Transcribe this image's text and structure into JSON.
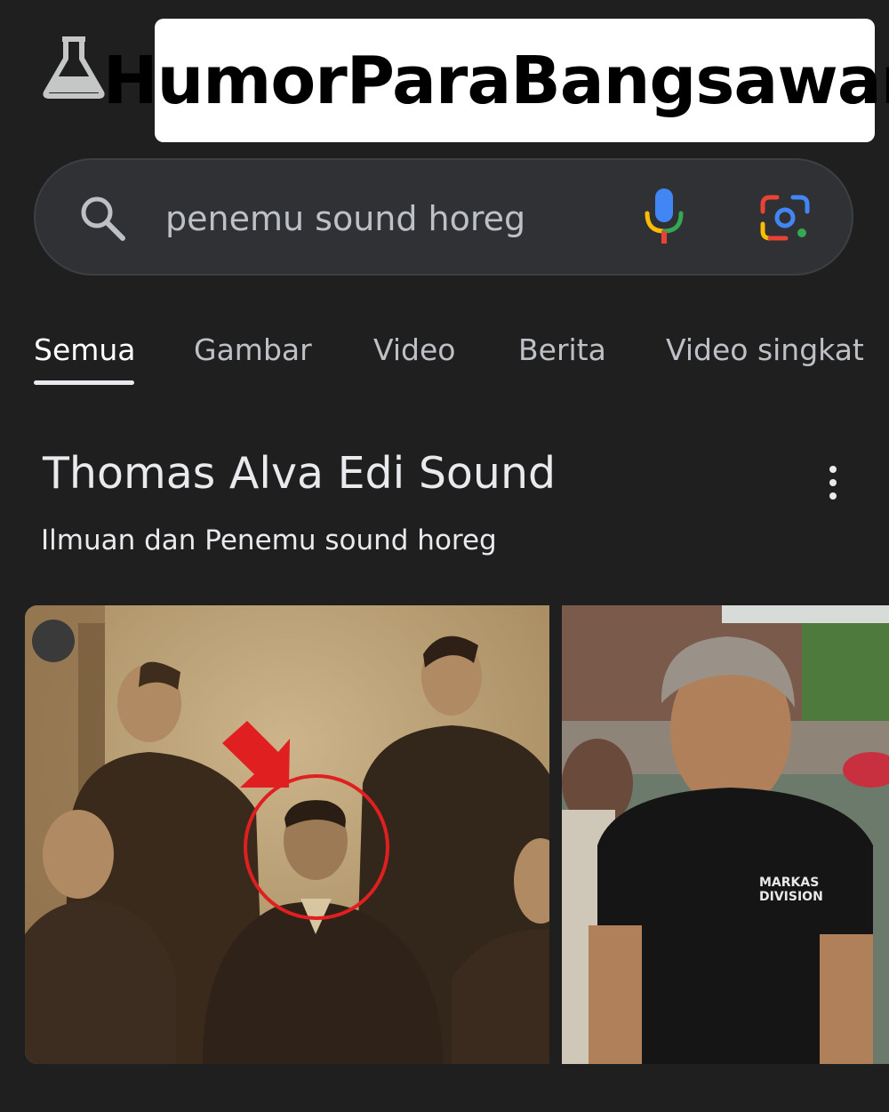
{
  "watermark": {
    "text": "HumorParaBangsawan"
  },
  "header": {
    "labs_icon": "flask-icon"
  },
  "search": {
    "query": "penemu sound horeg",
    "search_icon": "search-icon",
    "mic_icon": "mic-icon",
    "lens_icon": "lens-icon"
  },
  "tabs": [
    {
      "label": "Semua",
      "active": true
    },
    {
      "label": "Gambar",
      "active": false
    },
    {
      "label": "Video",
      "active": false
    },
    {
      "label": "Berita",
      "active": false
    },
    {
      "label": "Video singkat",
      "active": false
    }
  ],
  "knowledge_panel": {
    "title": "Thomas Alva Edi Sound",
    "subtitle": "Ilmuan dan Penemu sound horeg",
    "more_icon": "more-vert-icon",
    "images": [
      {
        "name": "vintage-group-photo",
        "annotation": "red arrow and circle"
      },
      {
        "name": "man-black-tshirt-photo",
        "shirt_text": "MARKAS DIVISION"
      }
    ]
  },
  "colors": {
    "background": "#1f1f1f",
    "search_bg": "#303134",
    "text_primary": "#e8eaed",
    "text_secondary": "#bdc1c6",
    "google_blue": "#4285f4",
    "google_red": "#ea4335",
    "google_yellow": "#fbbc04",
    "google_green": "#34a853",
    "annotation_red": "#e02020"
  }
}
